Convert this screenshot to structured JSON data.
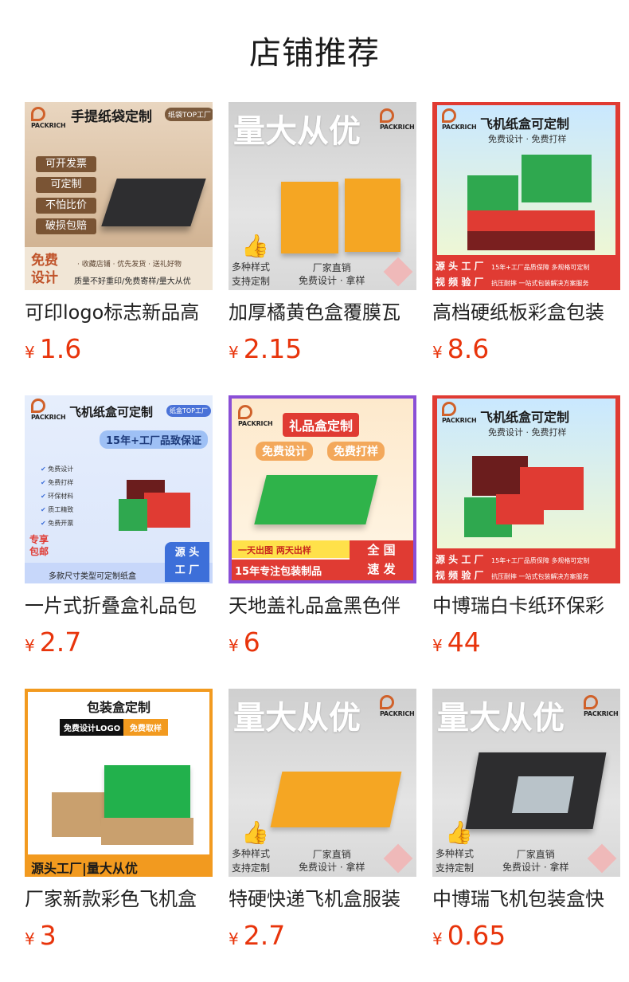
{
  "page": {
    "title": "店铺推荐"
  },
  "products": [
    {
      "name": "可印logo标志新品高",
      "currency": "¥",
      "price": "1.6",
      "img": {
        "brand": "PACKRICH",
        "heading": "手提纸袋定制",
        "tag": "纸袋TOP工厂",
        "bullets": [
          "可开发票",
          "可定制",
          "不怕比价",
          "破损包赔"
        ],
        "corner_big": [
          "免费",
          "设计"
        ],
        "footer_top": "· 收藏店铺  · 优先发货  · 送礼好物",
        "footer_bottom": "质量不好重印/免费寄样/量大从优"
      }
    },
    {
      "name": "加厚橘黄色盒覆膜瓦",
      "currency": "¥",
      "price": "2.15",
      "img": {
        "brand": "PACKRICH",
        "slogan": "量大从优",
        "left_line1": "多种样式",
        "left_line2": "支持定制",
        "right_line1": "厂家直销",
        "right_line2": "免费设计 · 拿样"
      }
    },
    {
      "name": "高档硬纸板彩盒包装",
      "currency": "¥",
      "price": "8.6",
      "img": {
        "brand": "PACKRICH",
        "heading": "飞机纸盒可定制",
        "sub": "免费设计 · 免费打样",
        "tag1": "源 头 工 厂",
        "tag2": "视 频 验 厂",
        "note1": "15年+工厂品质保障  多规格可定制",
        "note2": "抗压耐摔  一站式包装解决方案服务"
      }
    },
    {
      "name": "一片式折叠盒礼品包",
      "currency": "¥",
      "price": "2.7",
      "img": {
        "brand": "PACKRICH",
        "heading": "飞机纸盒可定制",
        "tag": "纸盒TOP工厂",
        "banner": "15年+工厂品致保证",
        "checks": [
          "免费设计",
          "免费打样",
          "环保材料",
          "质工精致",
          "免费开票"
        ],
        "corner": [
          "专享",
          "包邮"
        ],
        "footer": "多款尺寸类型可定制纸盒",
        "badge": [
          "源 头",
          "工 厂"
        ]
      }
    },
    {
      "name": "天地盖礼品盒黑色伴",
      "currency": "¥",
      "price": "6",
      "img": {
        "brand": "PACKRICH",
        "heading": "礼品盒定制",
        "pill1": "免费设计",
        "pill2": "免费打样",
        "strip1": "一天出图   两天出样",
        "strip2": "15年专注包装制品",
        "right1": "全 国",
        "right2": "速 发"
      }
    },
    {
      "name": "中博瑞白卡纸环保彩",
      "currency": "¥",
      "price": "44",
      "img": {
        "brand": "PACKRICH",
        "heading": "飞机纸盒可定制",
        "sub": "免费设计 · 免费打样",
        "tag1": "源 头 工 厂",
        "tag2": "视 频 验 厂",
        "note1": "15年+工厂品质保障  多规格可定制",
        "note2": "抗压耐摔  一站式包装解决方案服务"
      }
    },
    {
      "name": "厂家新款彩色飞机盒",
      "currency": "¥",
      "price": "3",
      "img": {
        "brand": "PACKRICH",
        "heading": "包装盒定制",
        "pill1": "免费设计LOGO",
        "pill2": "免费取样",
        "footer": "源头工厂|量大从优"
      }
    },
    {
      "name": "特硬快递飞机盒服装",
      "currency": "¥",
      "price": "2.7",
      "img": {
        "brand": "PACKRICH",
        "slogan": "量大从优",
        "left_line1": "多种样式",
        "left_line2": "支持定制",
        "right_line1": "厂家直销",
        "right_line2": "免费设计 · 拿样"
      }
    },
    {
      "name": "中博瑞飞机包装盒快",
      "currency": "¥",
      "price": "0.65",
      "img": {
        "brand": "PACKRICH",
        "slogan": "量大从优",
        "left_line1": "多种样式",
        "left_line2": "支持定制",
        "right_line1": "厂家直销",
        "right_line2": "免费设计 · 拿样"
      }
    }
  ]
}
